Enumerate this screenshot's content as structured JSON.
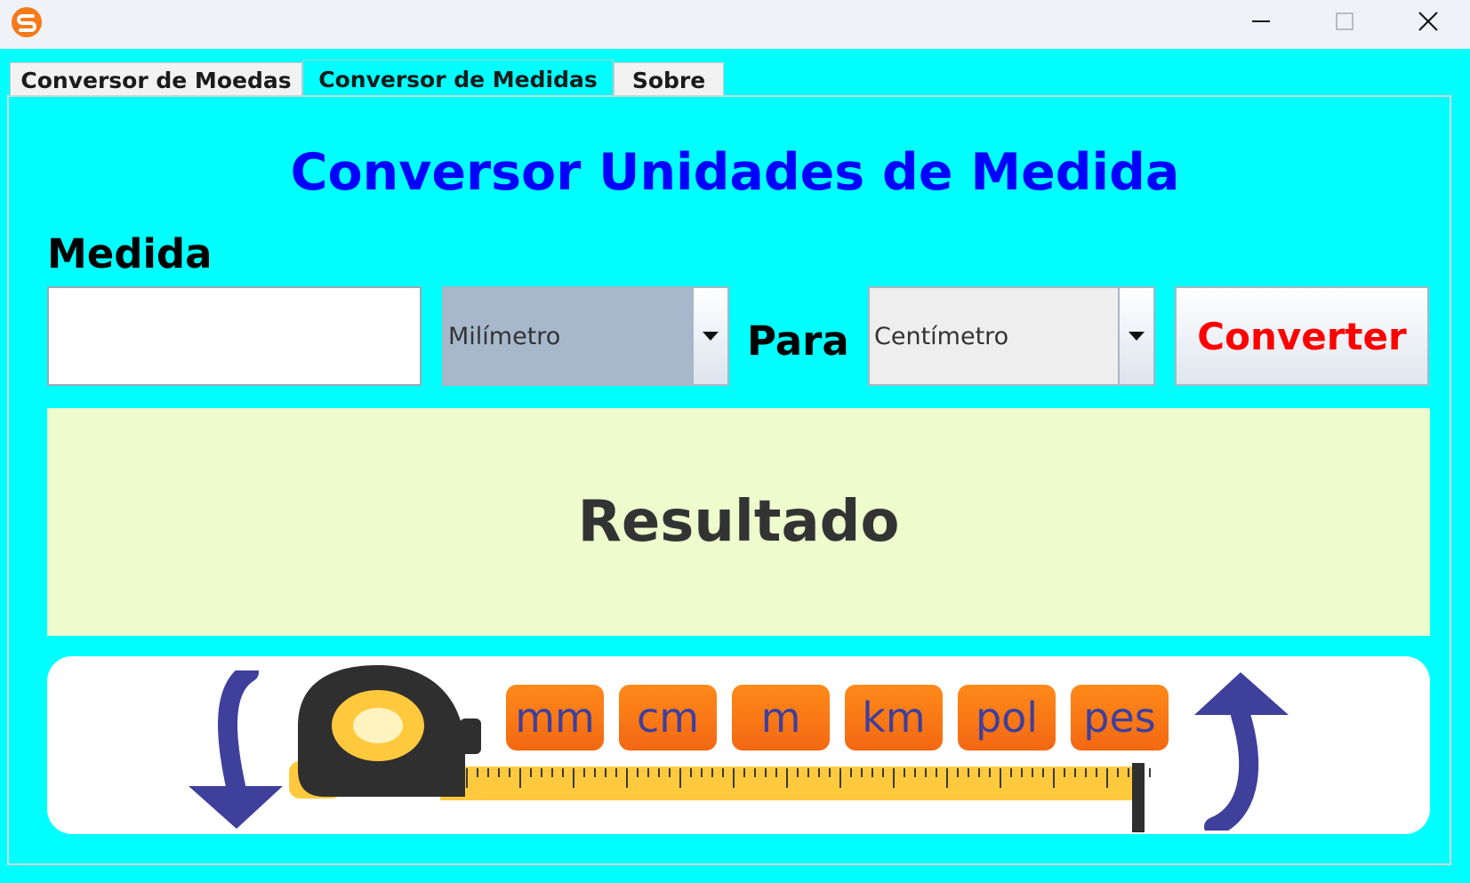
{
  "window": {
    "icon": "app-logo-icon",
    "controls": [
      "minimize-icon",
      "maximize-icon",
      "close-icon"
    ]
  },
  "tabs": [
    {
      "label": "Conversor de Moedas",
      "active": false
    },
    {
      "label": "Conversor de Medidas",
      "active": true
    },
    {
      "label": "Sobre",
      "active": false
    }
  ],
  "main": {
    "heading": "Conversor Unidades de Medida",
    "medida_label": "Medida",
    "medida_input": {
      "value": "",
      "placeholder": ""
    },
    "from_unit": "Milímetro",
    "para_label": "Para",
    "to_unit": "Centímetro",
    "convert_button": "Converter",
    "result": "Resultado"
  },
  "banner": {
    "units": [
      "mm",
      "cm",
      "m",
      "km",
      "pol",
      "pes"
    ]
  },
  "colors": {
    "background": "#00ffff",
    "heading": "#0000ff",
    "convert_text": "#ff0000",
    "result_bg": "#edfbcd",
    "unit_chip": "#f47a1a",
    "arrow": "#3f3f9c",
    "tape_yellow": "#ffc93d"
  }
}
